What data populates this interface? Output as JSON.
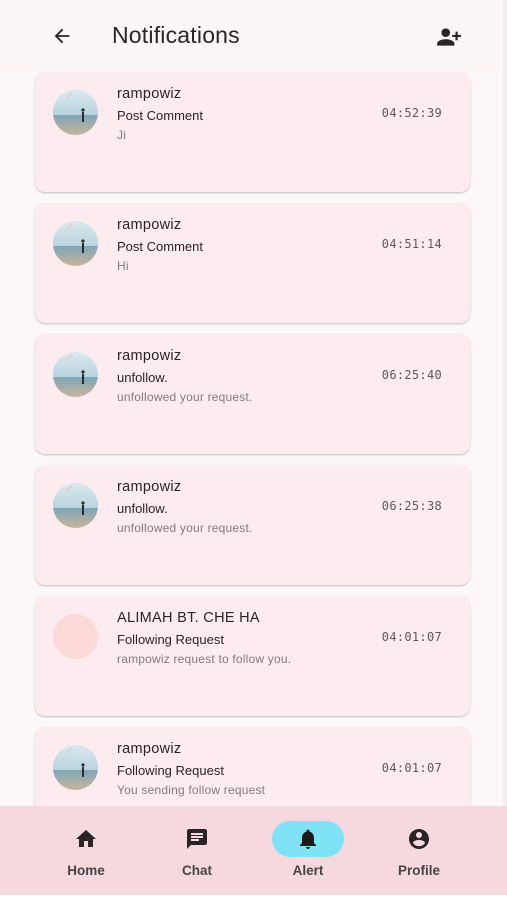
{
  "header": {
    "title": "Notifications",
    "back_icon": "arrow-left-icon",
    "action_icon": "person-add-icon"
  },
  "notifications": [
    {
      "name": "rampowiz",
      "type": "Post Comment",
      "message": "Ji",
      "time": "04:52:39",
      "avatar": "photo"
    },
    {
      "name": "rampowiz",
      "type": "Post Comment",
      "message": "Hi",
      "time": "04:51:14",
      "avatar": "photo"
    },
    {
      "name": "rampowiz",
      "type": "unfollow.",
      "message": "unfollowed your request.",
      "time": "06:25:40",
      "avatar": "photo"
    },
    {
      "name": "rampowiz",
      "type": "unfollow.",
      "message": "unfollowed your request.",
      "time": "06:25:38",
      "avatar": "photo"
    },
    {
      "name": "ALIMAH BT. CHE HA",
      "type": "Following Request",
      "message": "rampowiz request to follow you.",
      "time": "04:01:07",
      "avatar": "blank"
    },
    {
      "name": "rampowiz",
      "type": "Following Request",
      "message": "You sending follow request",
      "time": "04:01:07",
      "avatar": "photo"
    }
  ],
  "bottom_nav": {
    "items": [
      {
        "label": "Home",
        "icon": "home-icon",
        "active": false
      },
      {
        "label": "Chat",
        "icon": "chat-icon",
        "active": false
      },
      {
        "label": "Alert",
        "icon": "bell-icon",
        "active": true
      },
      {
        "label": "Profile",
        "icon": "account-circle-icon",
        "active": false
      }
    ],
    "active_color": "#7fe3f5"
  },
  "colors": {
    "card_background": "#fcecef",
    "nav_background": "#f5d9df",
    "page_background": "#fcf7f8"
  }
}
